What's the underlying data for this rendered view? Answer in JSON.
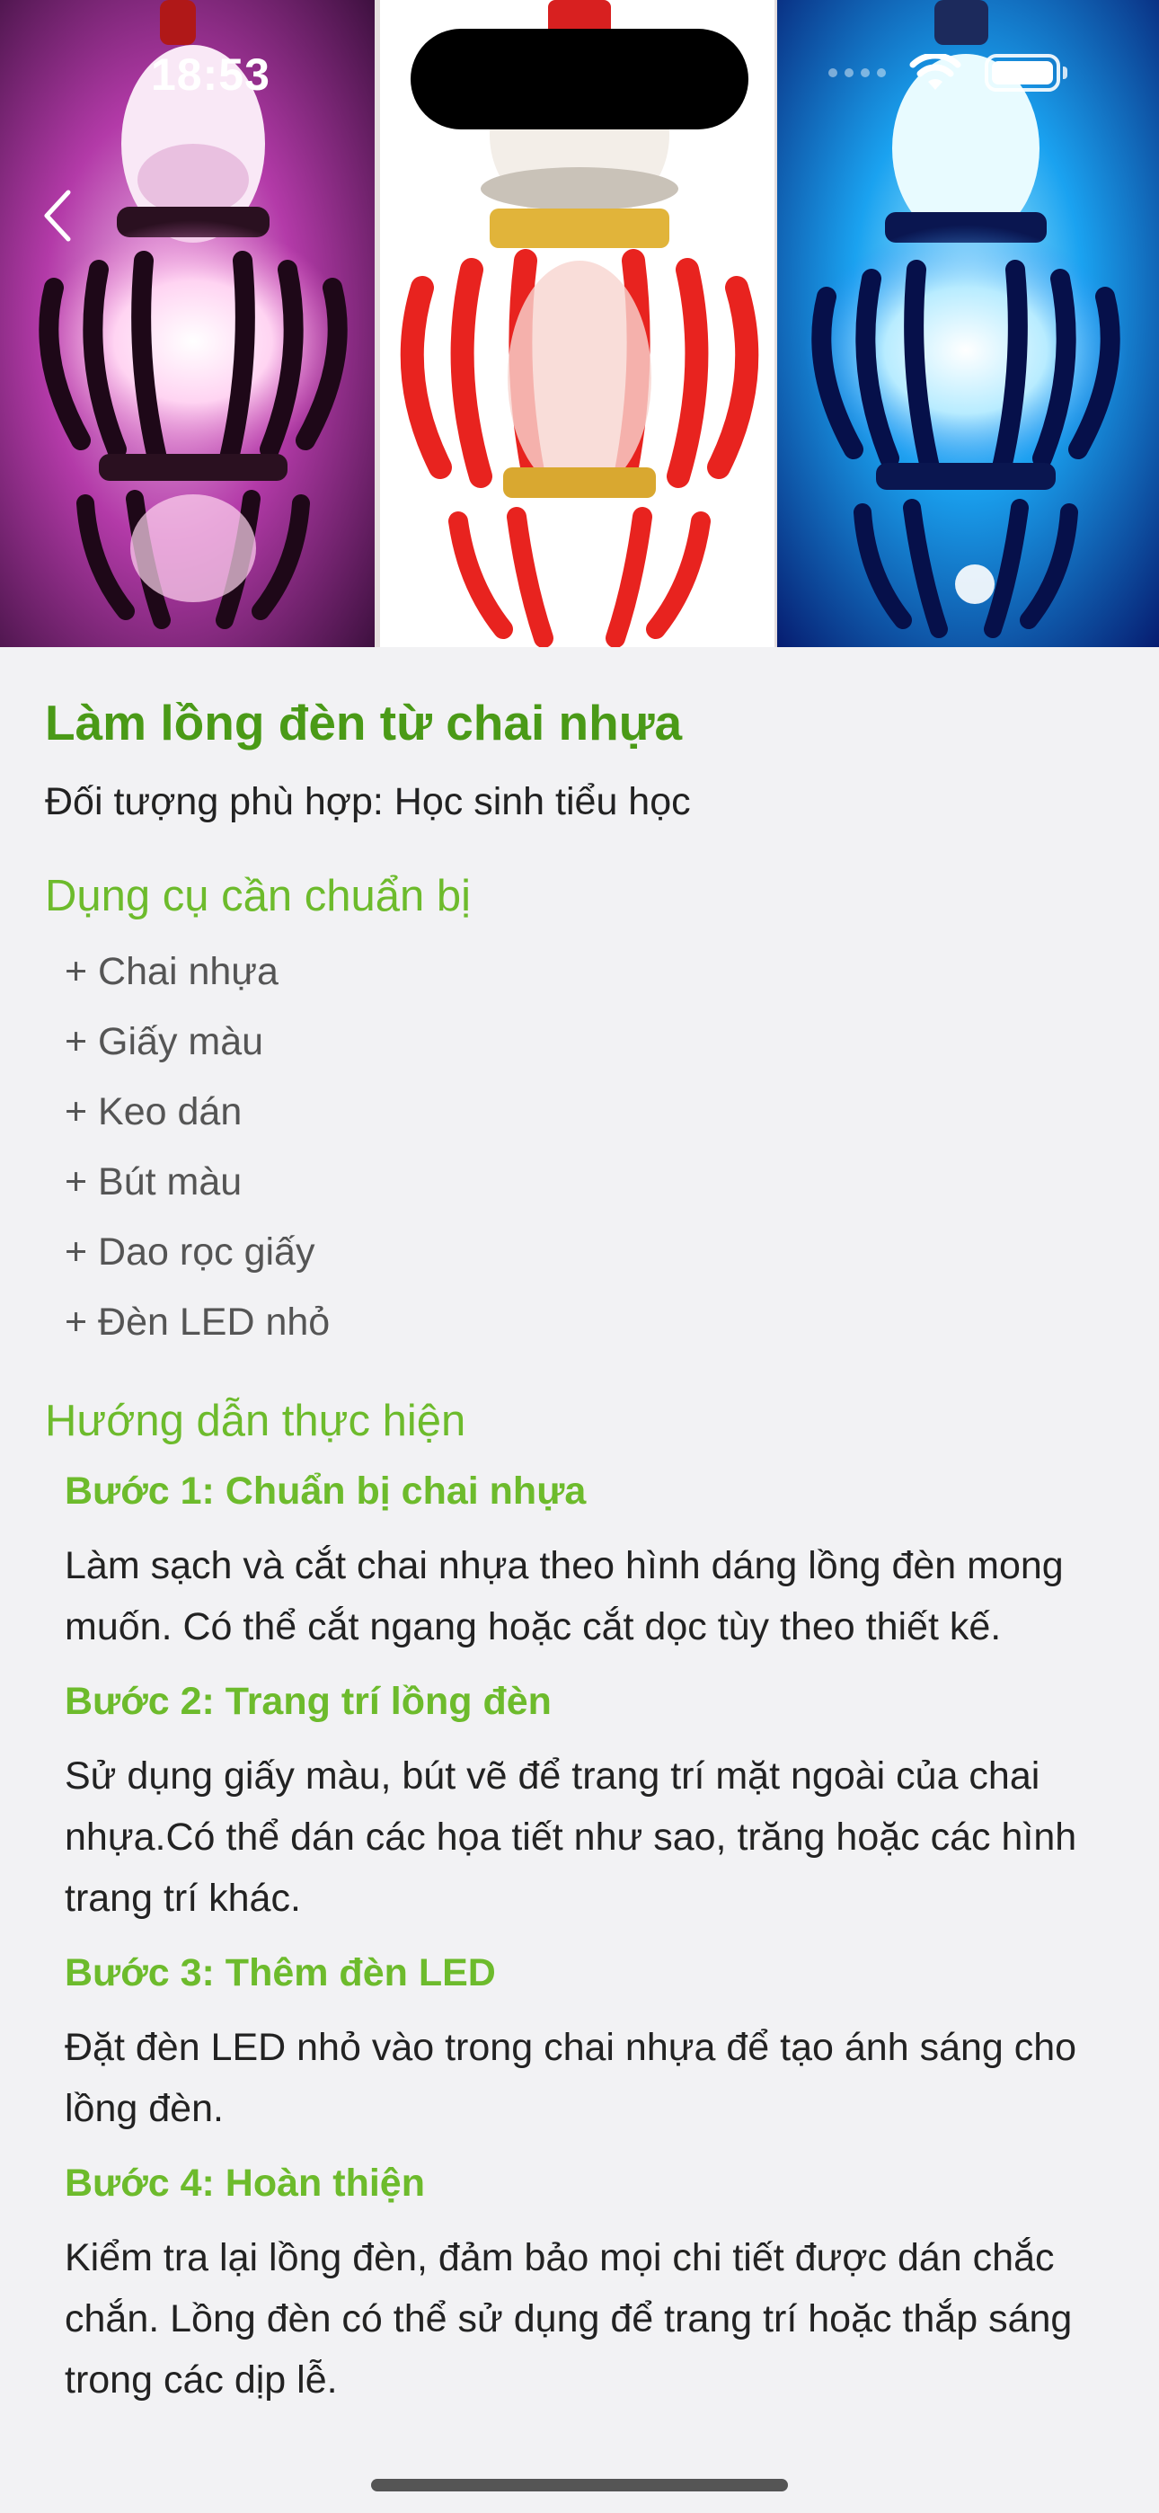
{
  "status_bar": {
    "time": "18:53"
  },
  "hero": {
    "image_alt": "lantern-photos"
  },
  "article": {
    "title": "Làm lồng đèn từ chai nhựa",
    "audience": "Đối tượng phù hợp: Học sinh tiểu học",
    "tools_heading": "Dụng cụ cần chuẩn bị",
    "tools": [
      "+ Chai nhựa",
      "+ Giấy màu",
      "+ Keo dán",
      "+ Bút màu",
      "+ Dao rọc giấy",
      "+ Đèn LED nhỏ"
    ],
    "guide_heading": "Hướng dẫn thực hiện",
    "steps": [
      {
        "title": "Bước 1: Chuẩn bị chai nhựa",
        "desc": "Làm sạch và cắt chai nhựa theo hình dáng lồng đèn mong muốn. Có thể cắt ngang hoặc cắt dọc tùy theo thiết kế."
      },
      {
        "title": "Bước 2: Trang trí lồng đèn",
        "desc": "Sử dụng giấy màu, bút vẽ để trang trí mặt ngoài của chai nhựa.Có thể dán các họa tiết như sao, trăng hoặc các hình trang trí khác."
      },
      {
        "title": "Bước 3: Thêm đèn LED",
        "desc": "Đặt đèn LED nhỏ vào trong chai nhựa để tạo ánh sáng cho lồng đèn."
      },
      {
        "title": "Bước 4: Hoàn thiện",
        "desc": "Kiểm tra lại lồng đèn, đảm bảo mọi chi tiết được dán chắc chắn. Lồng đèn có thể sử dụng để trang trí hoặc thắp sáng trong các dịp lễ."
      }
    ]
  },
  "colors": {
    "title": "#4a9a17",
    "heading": "#6dbb2c",
    "background": "#f2f2f4"
  }
}
